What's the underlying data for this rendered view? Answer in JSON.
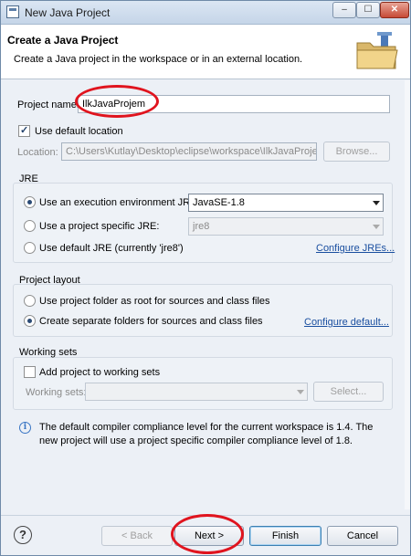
{
  "window": {
    "title": "New Java Project",
    "min_label": "‒",
    "max_label": "☐",
    "close_label": "✕"
  },
  "header": {
    "title": "Create a Java Project",
    "description": "Create a Java project in the workspace or in an external location."
  },
  "project": {
    "name_label": "Project name:",
    "name_value": "IlkJavaProjem",
    "use_default_location_label": "Use default location",
    "use_default_location_checked": true,
    "location_label": "Location:",
    "location_value": "C:\\Users\\Kutlay\\Desktop\\eclipse\\workspace\\IlkJavaProjem",
    "browse_label": "Browse..."
  },
  "jre": {
    "group_label": "JRE",
    "option_env_label": "Use an execution environment JRE:",
    "option_env_value": "JavaSE-1.8",
    "option_specific_label": "Use a project specific JRE:",
    "option_specific_value": "jre8",
    "option_default_label": "Use default JRE (currently 'jre8')",
    "configure_link": "Configure JREs...",
    "selected": "env"
  },
  "layout": {
    "group_label": "Project layout",
    "option_root_label": "Use project folder as root for sources and class files",
    "option_separate_label": "Create separate folders for sources and class files",
    "configure_link": "Configure default...",
    "selected": "separate"
  },
  "working_sets": {
    "group_label": "Working sets",
    "add_label": "Add project to working sets",
    "add_checked": false,
    "sets_label": "Working sets:",
    "select_label": "Select..."
  },
  "info": {
    "message": "The default compiler compliance level for the current workspace is 1.4. The new project will use a project specific compiler compliance level of 1.8."
  },
  "footer": {
    "help_icon": "?",
    "back_label": "< Back",
    "next_label": "Next >",
    "finish_label": "Finish",
    "cancel_label": "Cancel"
  },
  "colors": {
    "annotation_ring": "#e0141e",
    "link": "#1a4fa0",
    "dialog_bg": "#ecf0f6"
  }
}
